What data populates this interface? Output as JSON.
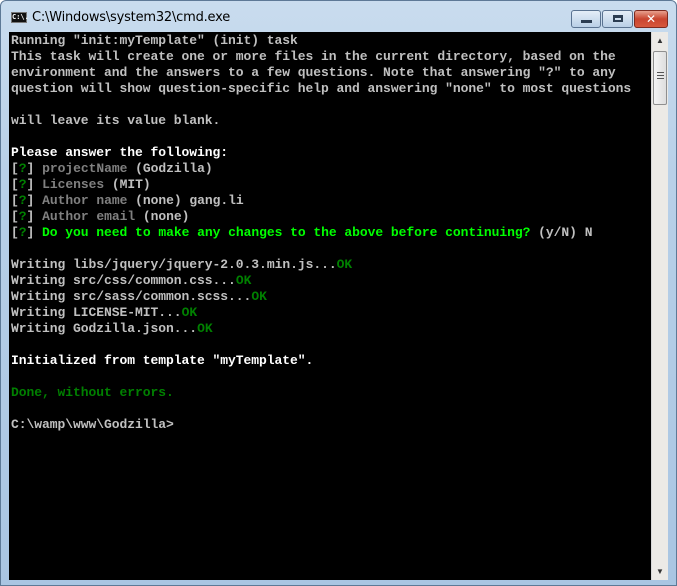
{
  "window": {
    "title": "C:\\Windows\\system32\\cmd.exe",
    "icon": "cmd-icon",
    "icon_text": "C:\\.",
    "controls": {
      "minimize": "minimize-icon",
      "maximize": "maximize-icon",
      "close": "close-icon",
      "close_glyph": "✕"
    }
  },
  "colors": {
    "background": "#000000",
    "text": "#c0c0c0",
    "bright": "#ffffff",
    "dim": "#808080",
    "dark_green": "#008000",
    "bright_green": "#00ff00",
    "close_button": "#c9452f"
  },
  "console": {
    "intro": [
      "Running \"init:myTemplate\" (init) task",
      "This task will create one or more files in the current directory, based on the",
      "environment and the answers to a few questions. Note that answering \"?\" to any",
      "question will show question-specific help and answering \"none\" to most questions",
      "",
      "will leave its value blank."
    ],
    "prompt_header": "Please answer the following:",
    "questions": [
      {
        "bracket_open": "[",
        "mark": "?",
        "bracket_close": "]",
        "label": "projectName",
        "default": "(Godzilla)",
        "answer": ""
      },
      {
        "bracket_open": "[",
        "mark": "?",
        "bracket_close": "]",
        "label": "Licenses",
        "default": "(MIT)",
        "answer": ""
      },
      {
        "bracket_open": "[",
        "mark": "?",
        "bracket_close": "]",
        "label": "Author name",
        "default": "(none)",
        "answer": "gang.li"
      },
      {
        "bracket_open": "[",
        "mark": "?",
        "bracket_close": "]",
        "label": "Author email",
        "default": "(none)",
        "answer": ""
      }
    ],
    "confirm": {
      "mark": "?",
      "question": "Do you need to make any changes to the above before continuing?",
      "options": "(y/N)",
      "answer": "N"
    },
    "writes": [
      {
        "prefix": "Writing",
        "file": "libs/jquery/jquery-2.0.3.min.js...",
        "status": "OK"
      },
      {
        "prefix": "Writing",
        "file": "src/css/common.css...",
        "status": "OK"
      },
      {
        "prefix": "Writing",
        "file": "src/sass/common.scss...",
        "status": "OK"
      },
      {
        "prefix": "Writing",
        "file": "LICENSE-MIT...",
        "status": "OK"
      },
      {
        "prefix": "Writing",
        "file": "Godzilla.json...",
        "status": "OK"
      }
    ],
    "initialized": "Initialized from template \"myTemplate\".",
    "done": "Done, without errors.",
    "prompt": "C:\\wamp\\www\\Godzilla>"
  },
  "scrollbar": {
    "up_arrow": "▲",
    "down_arrow": "▼"
  }
}
